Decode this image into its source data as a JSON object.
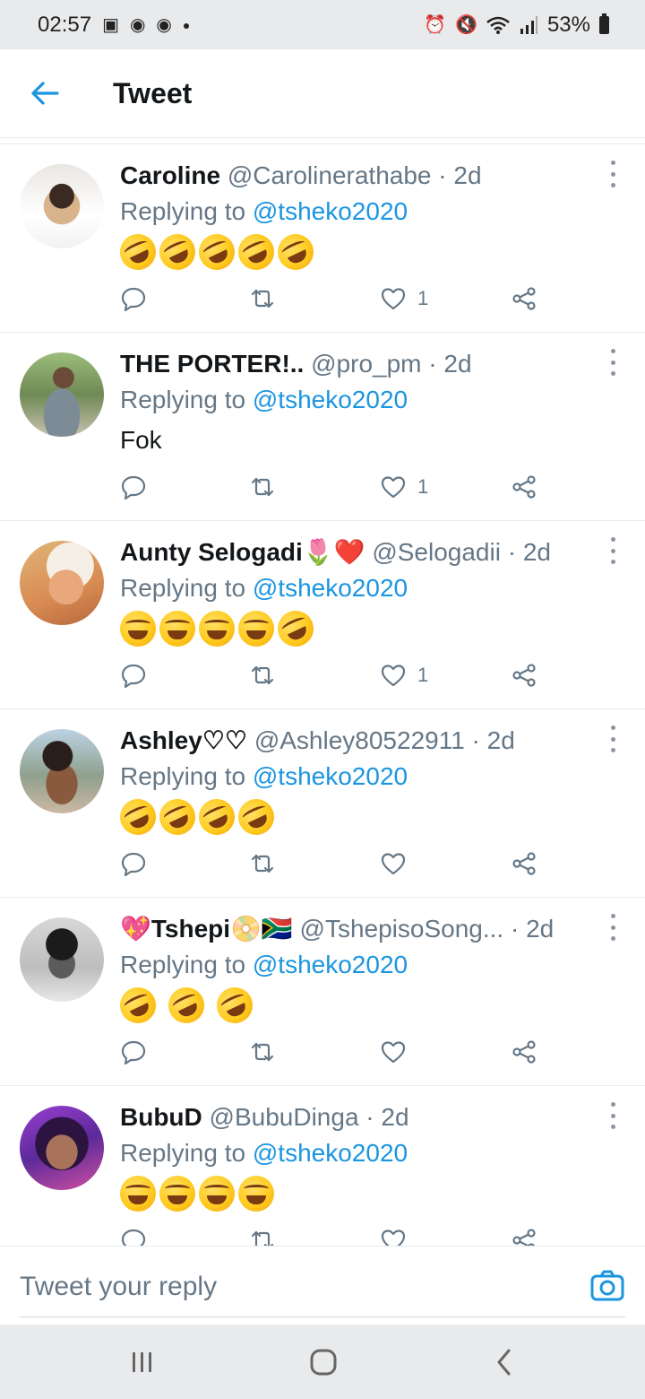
{
  "status_bar": {
    "time": "02:57",
    "left_icons": [
      "image-icon",
      "chrome-icon",
      "chrome-icon",
      "dot-icon"
    ],
    "right_icons": [
      "alarm-icon",
      "mute-icon",
      "wifi-icon",
      "signal-icon"
    ],
    "battery": "53%"
  },
  "header": {
    "title": "Tweet"
  },
  "colors": {
    "accent": "#1b95e0",
    "text_primary": "#14171a",
    "text_secondary": "#657786",
    "divider": "#e6ecf0",
    "system_bar": "#e9eaec"
  },
  "tweets": [
    {
      "name": "Caroline",
      "handle": "@Carolinerathabe",
      "meta": " · 2d",
      "replying_prefix": "Replying to ",
      "replying_to": "@tsheko2020",
      "text": "",
      "emojis": [
        "rofl",
        "rofl",
        "rofl",
        "rofl",
        "rofl"
      ],
      "like_count": "1"
    },
    {
      "name": "THE PORTER!..",
      "handle": "@pro_pm",
      "meta": " · 2d",
      "replying_prefix": "Replying to ",
      "replying_to": "@tsheko2020",
      "text": "Fok",
      "emojis": [],
      "like_count": "1"
    },
    {
      "name": "Aunty Selogadi🌷❤️",
      "handle": "@Selogadii",
      "meta": " · 2d",
      "replying_prefix": "Replying to ",
      "replying_to": "@tsheko2020",
      "text": "",
      "emojis": [
        "joy",
        "joy",
        "joy",
        "joy",
        "rofl"
      ],
      "like_count": "1"
    },
    {
      "name": "Ashley♡♡",
      "handle": "@Ashley80522911",
      "meta": " · 2d",
      "replying_prefix": "Replying to ",
      "replying_to": "@tsheko2020",
      "text": "",
      "emojis": [
        "rofl",
        "rofl",
        "rofl",
        "rofl"
      ],
      "like_count": ""
    },
    {
      "name": "💖Tshepi📀🇿🇦",
      "handle": "@TshepisoSong...",
      "meta": " · 2d",
      "replying_prefix": "Replying to ",
      "replying_to": "@tsheko2020",
      "text": "",
      "emojis": [
        "rofl",
        "rofl",
        "rofl"
      ],
      "like_count": ""
    },
    {
      "name": "BubuD",
      "handle": "@BubuDinga",
      "meta": " · 2d",
      "replying_prefix": "Replying to ",
      "replying_to": "@tsheko2020",
      "text": "",
      "emojis": [
        "joy",
        "joy",
        "joy",
        "joy"
      ],
      "like_count": ""
    }
  ],
  "reply_bar": {
    "placeholder": "Tweet your reply"
  },
  "nav_bar": {
    "buttons": [
      "recents-icon",
      "home-icon",
      "back-icon"
    ]
  }
}
